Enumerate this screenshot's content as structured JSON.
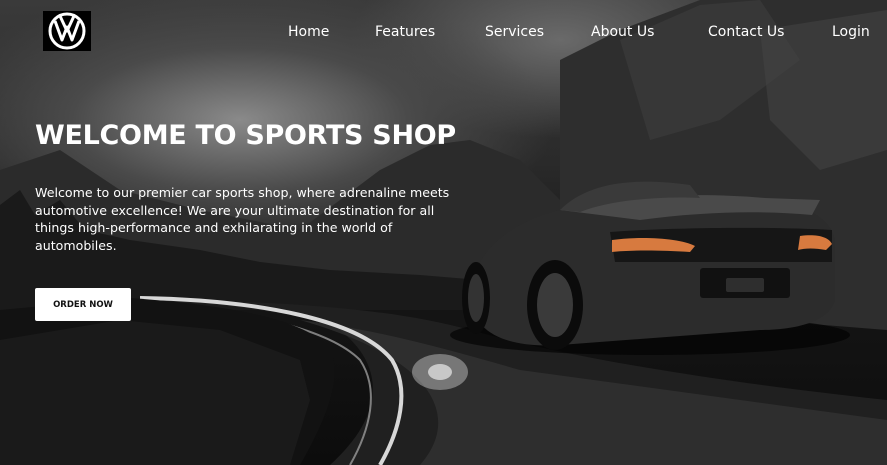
{
  "brand": {
    "logo_icon": "vw-logo-icon",
    "logo_bg": "#000000"
  },
  "nav": {
    "items": [
      {
        "label": "Home"
      },
      {
        "label": "Features"
      },
      {
        "label": "Services"
      },
      {
        "label": "About Us"
      },
      {
        "label": "Contact Us"
      },
      {
        "label": "Login"
      }
    ]
  },
  "hero": {
    "title": "WELCOME TO SPORTS SHOP",
    "description": "Welcome to our premier car sports shop, where adrenaline meets automotive excellence! We are your ultimate destination for all things high-performance and exhilarating in the world of automobiles.",
    "cta_label": "ORDER NOW",
    "background_image": "black-sports-car-on-wet-mountain-road"
  },
  "colors": {
    "text": "#ffffff",
    "button_bg": "#ffffff",
    "button_text": "#111111"
  }
}
